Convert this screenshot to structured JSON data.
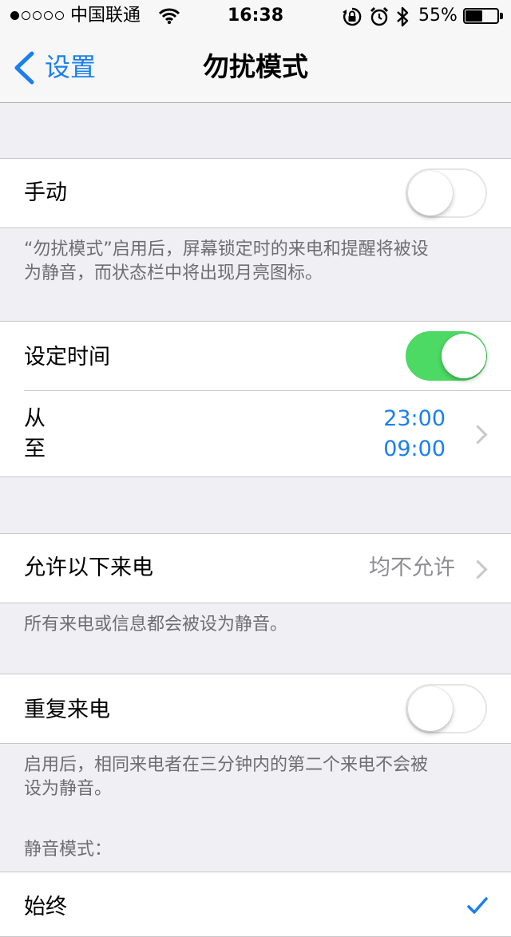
{
  "status_bar": {
    "carrier": "中国联通",
    "time": "16:38",
    "battery": "55%",
    "battery_level": 0.55,
    "signal_bars_filled": 1,
    "signal_bars_total": 5
  },
  "nav": {
    "back_label": "设置",
    "title": "勿扰模式"
  },
  "manual": {
    "label": "手动",
    "enabled": false,
    "footer_line1": "“勿扰模式”启用后，屏幕锁定时的来电和提醒将被设",
    "footer_line2": "为静音，而状态栏中将出现月亮图标。"
  },
  "scheduled": {
    "label": "设定时间",
    "enabled": true,
    "from_label": "从",
    "to_label": "至",
    "from_time": "23:00",
    "to_time": "09:00"
  },
  "allow_calls": {
    "label": "允许以下来电",
    "value": "均不允许",
    "footer": "所有来电或信息都会被设为静音。"
  },
  "repeated_calls": {
    "label": "重复来电",
    "enabled": false,
    "footer_line1": "启用后，相同来电者在三分钟内的第二个来电不会被",
    "footer_line2": "设为静音。"
  },
  "silence": {
    "header": "静音模式：",
    "option_always": "始终"
  },
  "colors": {
    "accent": "#1a7ff0",
    "toggle_on": "#4cd964",
    "background": "#efeff4"
  }
}
